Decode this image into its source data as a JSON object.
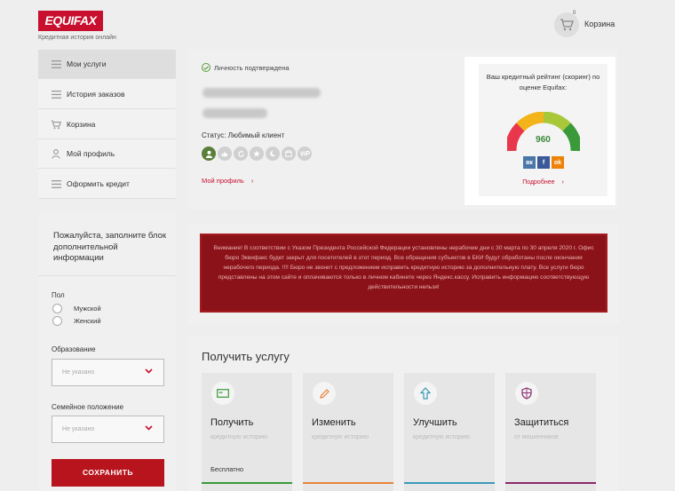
{
  "header": {
    "logo": "EQUIFAX",
    "tagline": "Кредитная история онлайн",
    "cart_label": "Корзина",
    "cart_count": "0"
  },
  "nav": {
    "items": [
      {
        "label": "Мои услуги",
        "icon": "grid-icon",
        "active": true
      },
      {
        "label": "История заказов",
        "icon": "list-icon"
      },
      {
        "label": "Корзина",
        "icon": "cart-icon"
      },
      {
        "label": "Мой профиль",
        "icon": "user-icon"
      },
      {
        "label": "Оформить кредит",
        "icon": "list-icon"
      }
    ]
  },
  "profile_form": {
    "hint": "Пожалуйста, заполните блок дополнительной информации",
    "gender_label": "Пол",
    "gender_options": [
      "Мужской",
      "Женский"
    ],
    "education_label": "Образование",
    "education_value": "Не указано",
    "family_label": "Семейное положение",
    "family_value": "Не указано",
    "save_label": "СОХРАНИТЬ"
  },
  "user": {
    "verified": "Личность подтверждена",
    "status": "Статус: Любимый клиент",
    "my_profile": "Мой профиль",
    "badges": [
      "user",
      "like",
      "refresh",
      "star",
      "moon",
      "box",
      "vip"
    ]
  },
  "rating": {
    "title": "Ваш кредитный рейтинг (скоринг) по оценке Equifax:",
    "score": "960",
    "more": "Подробнее",
    "gauge_colors": [
      "#e8374a",
      "#f2b41a",
      "#a8c83a",
      "#3a9a3a"
    ],
    "socials": [
      {
        "name": "vk",
        "label": "вк",
        "color": "#4a76a8"
      },
      {
        "name": "facebook",
        "label": "f",
        "color": "#3b5998"
      },
      {
        "name": "odnoklassniki",
        "label": "ok",
        "color": "#ee8208"
      }
    ]
  },
  "notice": {
    "text": "Внимание! В соответствии с Указом Президента Российской Федерации установлены нерабочие дни с 30 марта по 30 апреля 2020 г. Офис бюро Эквифакс будет закрыт для посетителей в этот период. Все обращения субъектов в БКИ будут обработаны после окончания нерабочего периода. !!!! Бюро не звонит с предложением исправить кредитную историю за дополнительную плату. Все услуги бюро представлены на этом сайте и оплачиваются только в личном кабинете через Яндекс.кассу. Исправить информацию соответствующую действительности нельзя!"
  },
  "services": {
    "title": "Получить услугу",
    "items": [
      {
        "title": "Получить",
        "subtitle": "кредитную историю",
        "price": "Бесплатно",
        "icon": "card-icon",
        "color": "#3a9a3a"
      },
      {
        "title": "Изменить",
        "subtitle": "кредитную историю",
        "price": "",
        "icon": "pencil-icon",
        "color": "#e8843a"
      },
      {
        "title": "Улучшить",
        "subtitle": "кредитную историю",
        "price": "",
        "icon": "arrow-up-icon",
        "color": "#3a9ab8"
      },
      {
        "title": "Защититься",
        "subtitle": "от мошенников",
        "price": "",
        "icon": "shield-icon",
        "color": "#8a2a6a"
      }
    ]
  }
}
